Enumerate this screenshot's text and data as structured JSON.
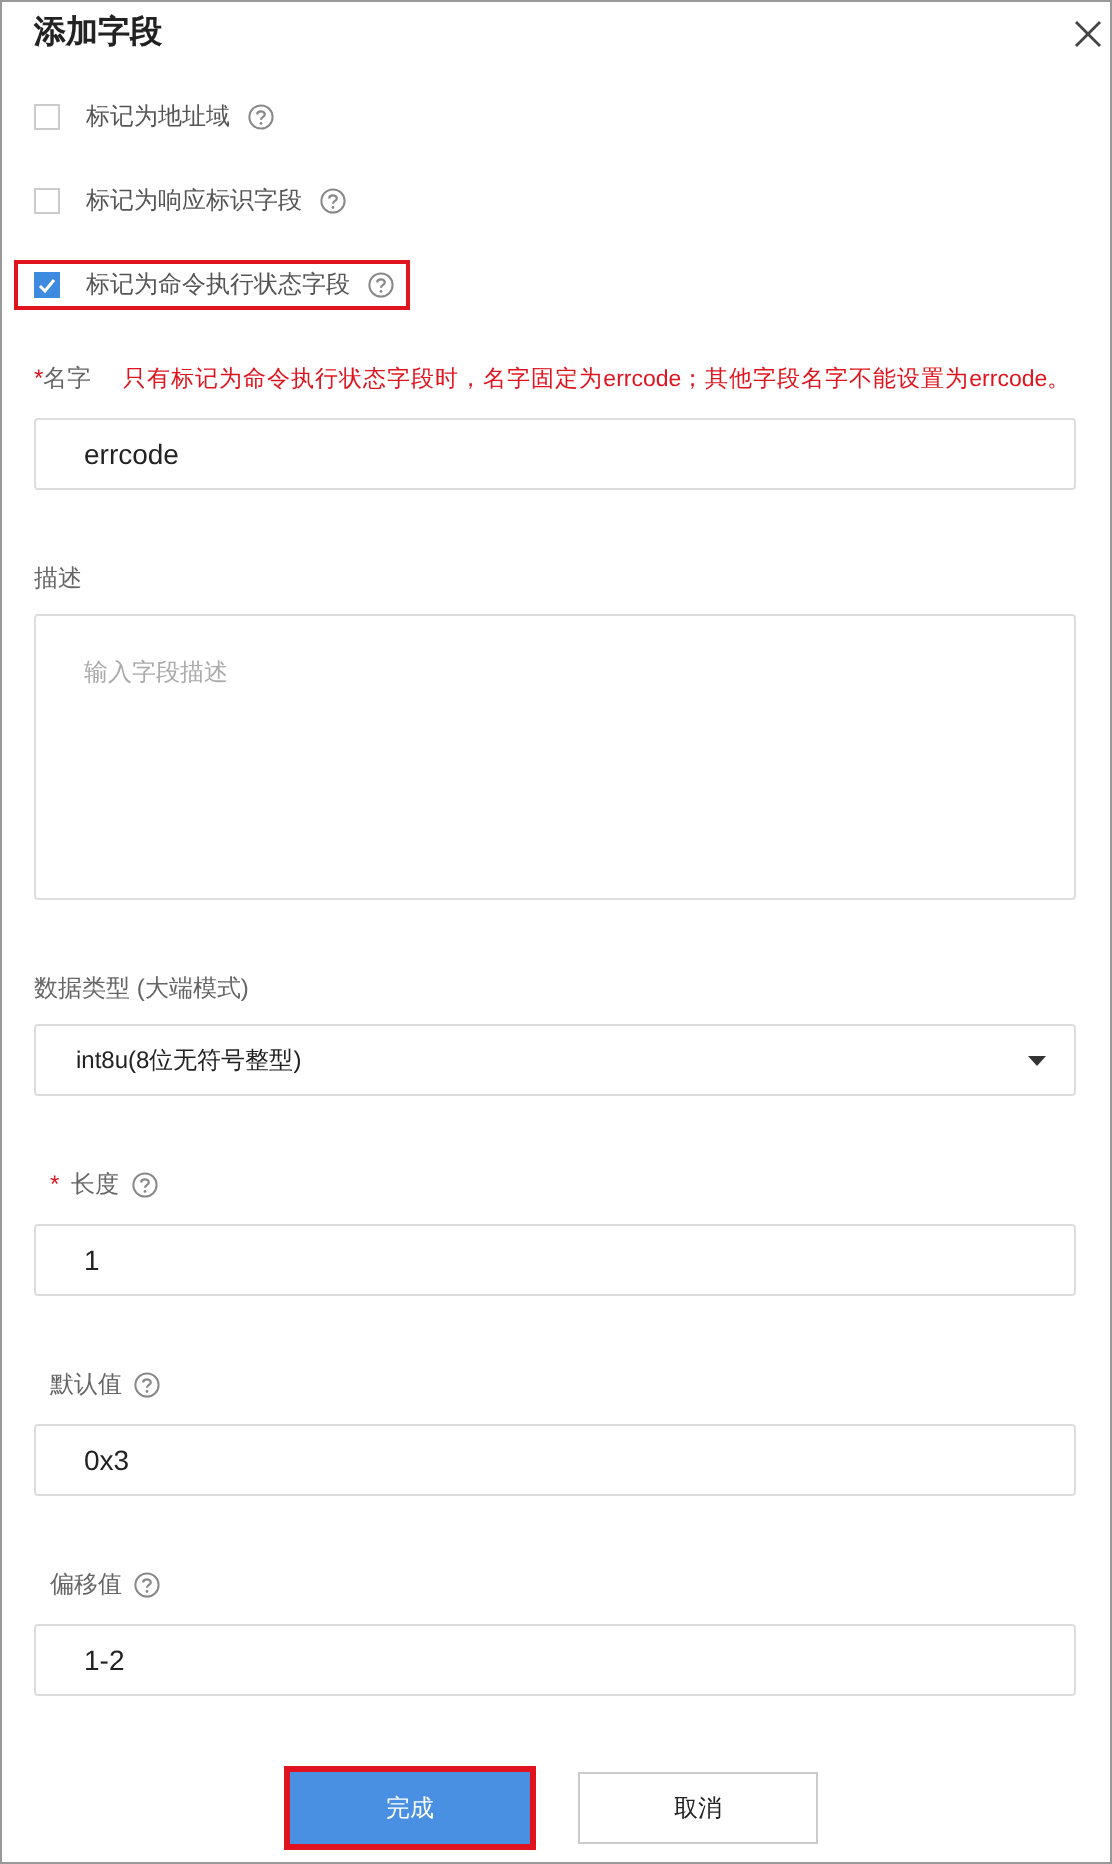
{
  "dialog": {
    "title": "添加字段"
  },
  "checkboxes": [
    {
      "label": "标记为地址域",
      "checked": false,
      "highlighted": false
    },
    {
      "label": "标记为响应标识字段",
      "checked": false,
      "highlighted": false
    },
    {
      "label": "标记为命令执行状态字段",
      "checked": true,
      "highlighted": true
    }
  ],
  "fields": [
    {
      "kind": "input",
      "label": "名字",
      "required_mark": "*",
      "hint": "只有标记为命令执行状态字段时，名字固定为errcode；其他字段名字不能设置为errcode。",
      "value": "errcode",
      "help": false
    },
    {
      "kind": "textarea",
      "label": "描述",
      "placeholder": "输入字段描述",
      "help": false
    },
    {
      "kind": "select",
      "label": "数据类型 (大端模式)",
      "value": "int8u(8位无符号整型)",
      "help": false
    },
    {
      "kind": "input",
      "label": "长度",
      "required_mark": "*",
      "value": "1",
      "help": true
    },
    {
      "kind": "input",
      "label": "默认值",
      "value": "0x3",
      "help": true
    },
    {
      "kind": "input",
      "label": "偏移值",
      "value": "1-2",
      "help": true
    }
  ],
  "buttons": [
    {
      "label": "完成",
      "kind": "primary",
      "highlighted": true
    },
    {
      "label": "取消",
      "kind": "secondary",
      "highlighted": false
    }
  ]
}
